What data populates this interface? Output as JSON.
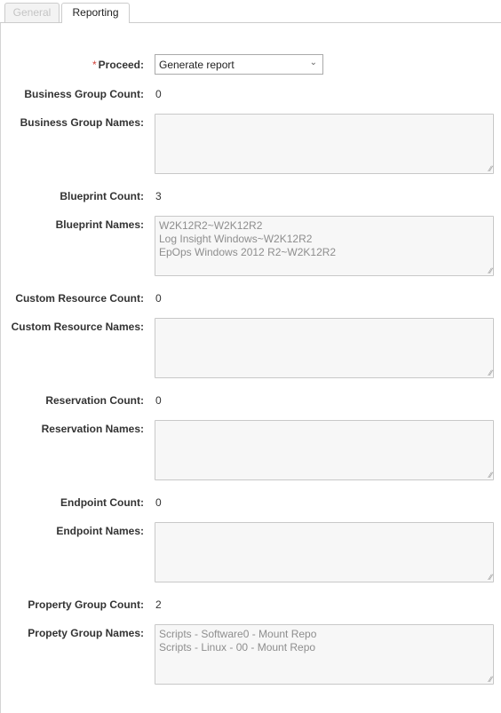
{
  "tabs": [
    {
      "label": "General",
      "active": false
    },
    {
      "label": "Reporting",
      "active": true
    }
  ],
  "form": {
    "proceed": {
      "label": "Proceed:",
      "required_marker": "*",
      "value": "Generate report"
    },
    "business_group_count": {
      "label": "Business Group Count:",
      "value": "0"
    },
    "business_group_names": {
      "label": "Business Group Names:",
      "lines": []
    },
    "blueprint_count": {
      "label": "Blueprint Count:",
      "value": "3"
    },
    "blueprint_names": {
      "label": "Blueprint Names:",
      "lines": [
        "W2K12R2~W2K12R2",
        "Log Insight Windows~W2K12R2",
        "EpOps Windows 2012 R2~W2K12R2"
      ]
    },
    "custom_resource_count": {
      "label": "Custom Resource Count:",
      "value": "0"
    },
    "custom_resource_names": {
      "label": "Custom Resource Names:",
      "lines": []
    },
    "reservation_count": {
      "label": "Reservation Count:",
      "value": "0"
    },
    "reservation_names": {
      "label": "Reservation Names:",
      "lines": []
    },
    "endpoint_count": {
      "label": "Endpoint Count:",
      "value": "0"
    },
    "endpoint_names": {
      "label": "Endpoint Names:",
      "lines": []
    },
    "property_group_count": {
      "label": "Property Group Count:",
      "value": "2"
    },
    "property_group_names": {
      "label": "Propety Group Names:",
      "lines": [
        "Scripts - Software0 - Mount Repo",
        "Scripts - Linux - 00 - Mount Repo"
      ]
    }
  },
  "icons": {
    "dropdown": "chevron-down-icon",
    "resize": "resize-grip-icon"
  },
  "colors": {
    "required": "#d0413a",
    "textarea_bg": "#f7f7f7",
    "tab_border": "#cccccc"
  }
}
